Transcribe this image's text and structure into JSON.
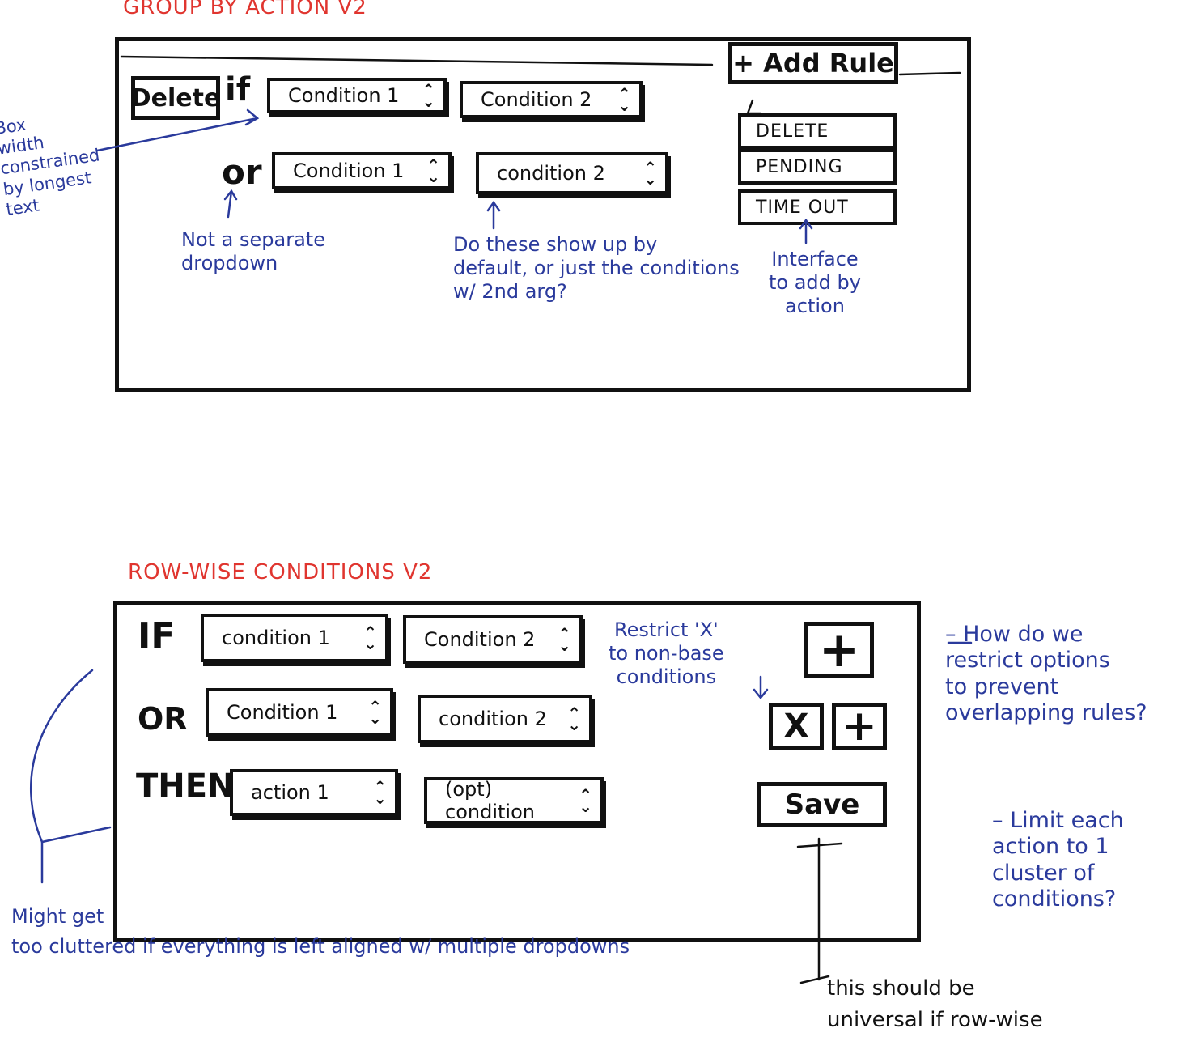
{
  "sketch1": {
    "title": "GROUP BY ACTION V2",
    "add_rule_label": "+ Add Rule",
    "action_chip": "Delete",
    "if_word": "if",
    "or_word": "or",
    "row1": {
      "cond1": "Condition 1",
      "cond2": "Condition 2"
    },
    "row2": {
      "cond1": "Condition 1",
      "cond2": "condition 2"
    },
    "menu": [
      "DELETE",
      "PENDING",
      "TIME OUT"
    ],
    "notes": {
      "box_width": "Box\nwidth\nconstrained\nby longest\ntext",
      "not_separate": "Not a separate\ndropdown",
      "show_default": "Do these show up by\ndefault, or just the conditions\nw/ 2nd arg?",
      "interface": "Interface\nto add by\naction"
    }
  },
  "sketch2": {
    "title": "ROW-WISE CONDITIONS V2",
    "if_word": "IF",
    "or_word": "OR",
    "then_word": "THEN",
    "row_if": {
      "cond1": "condition 1",
      "cond2": "Condition 2"
    },
    "row_or": {
      "cond1": "Condition 1",
      "cond2": "condition 2"
    },
    "row_then": {
      "action": "action 1",
      "opt": "(opt) condition"
    },
    "plus_label": "+",
    "x_label": "X",
    "save_label": "Save",
    "notes": {
      "restrict_x": "Restrict 'X'\nto non-base\nconditions",
      "how_restrict": "– How do we\nrestrict options\nto prevent\noverlapping rules?",
      "limit_each": "– Limit each\naction to 1\ncluster of\nconditions?",
      "cluttered": "Might get\ntoo cluttered if everything is left aligned w/ multiple dropdowns",
      "universal": "this should be\nuniversal if row-wise"
    }
  }
}
